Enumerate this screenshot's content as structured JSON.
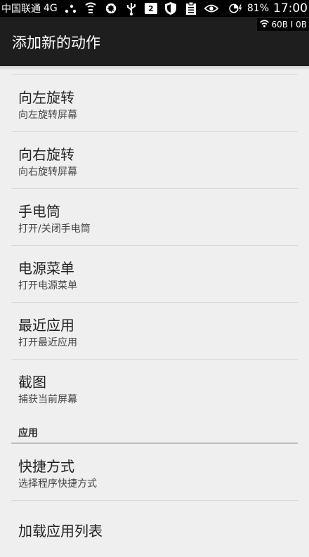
{
  "status_bar": {
    "carrier": "中国联通",
    "network": "4G",
    "notification_badge": "2",
    "battery": "81%",
    "time": "17:00",
    "net_speed": "60B I 0B"
  },
  "app_bar": {
    "title": "添加新的动作"
  },
  "actions": [
    {
      "title": "向左旋转",
      "subtitle": "向左旋转屏幕"
    },
    {
      "title": "向右旋转",
      "subtitle": "向右旋转屏幕"
    },
    {
      "title": "手电筒",
      "subtitle": "打开/关闭手电筒"
    },
    {
      "title": "电源菜单",
      "subtitle": "打开电源菜单"
    },
    {
      "title": "最近应用",
      "subtitle": "打开最近应用"
    },
    {
      "title": "截图",
      "subtitle": "捕获当前屏幕"
    }
  ],
  "apps_section": {
    "header": "应用",
    "items": [
      {
        "title": "快捷方式",
        "subtitle": "选择程序快捷方式"
      },
      {
        "title": "加载应用列表"
      }
    ]
  }
}
